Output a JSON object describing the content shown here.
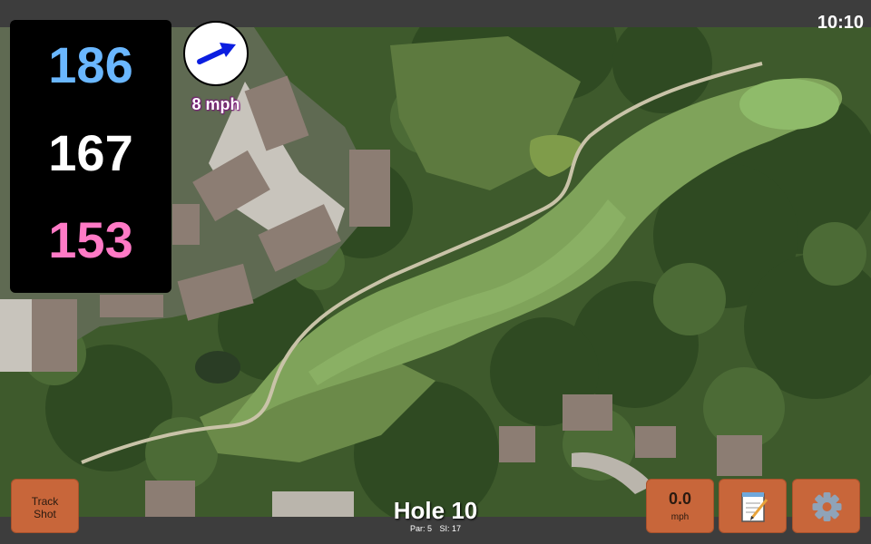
{
  "status": {
    "time": "10:10"
  },
  "distances": {
    "back": "186",
    "middle": "167",
    "front": "153"
  },
  "wind_indicator": {
    "speed_label": "8 mph",
    "direction_icon": "wind-arrow-icon"
  },
  "hole": {
    "title": "Hole 10",
    "par": "Par: 5",
    "si": "SI: 17"
  },
  "buttons": {
    "track_shot": {
      "line1": "Track",
      "line2": "Shot"
    },
    "wind": {
      "value": "0.0",
      "unit": "mph"
    },
    "notes_icon": "notepad-icon",
    "settings_icon": "gear-icon"
  },
  "colors": {
    "back_distance": "#6ab7ff",
    "middle_distance": "#ffffff",
    "front_distance": "#ff7ac6",
    "button_bg": "#c8663a",
    "bar_bg": "#3d3d3d",
    "wind_arrow": "#0b1ee0"
  }
}
